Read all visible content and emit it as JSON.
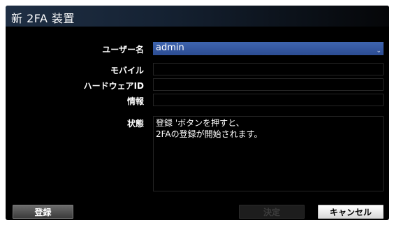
{
  "dialog": {
    "title": "新 2FA 装置"
  },
  "form": {
    "username_label": "ユーザー名",
    "username_value": "admin",
    "mobile_label": "モバイル",
    "mobile_value": "",
    "hardware_id_label": "ハードウェアID",
    "hardware_id_value": "",
    "info_label": "情報",
    "info_value": "",
    "status_label": "状態",
    "status_lines": [
      "登録 'ボタンを押すと、",
      "2FAの登録が開始されます。"
    ]
  },
  "buttons": {
    "register": "登録",
    "ok": "決定",
    "cancel": "キャンセル"
  },
  "icons": {
    "dropdown": "chevron-down-icon"
  },
  "colors": {
    "select_bg": "#3a5ea8",
    "dialog_bg": "#000000",
    "title_bar": "#1f2f44"
  }
}
